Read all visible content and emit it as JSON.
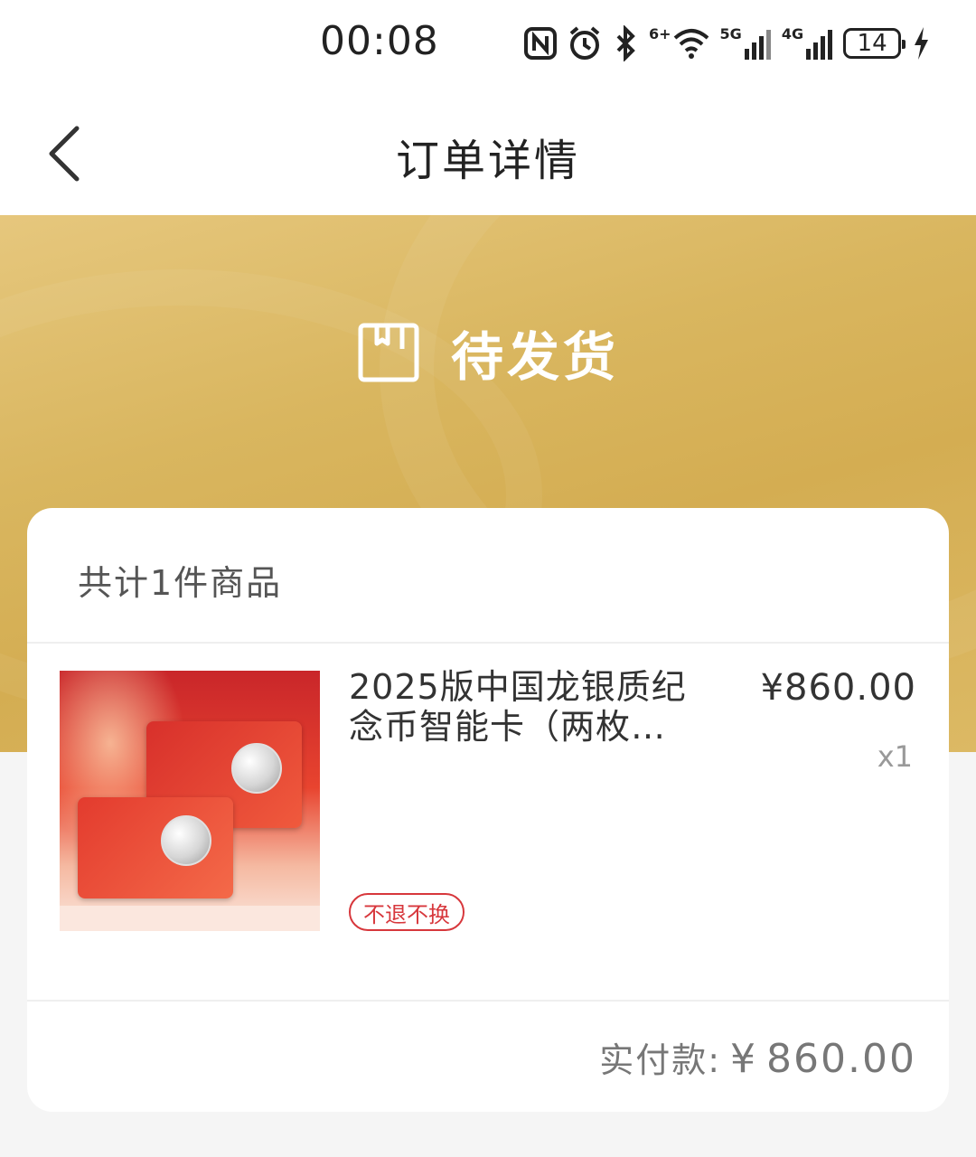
{
  "status_bar": {
    "time": "00:08",
    "network_1": "5G",
    "network_2": "4G",
    "wifi_tag": "6+",
    "battery": "14"
  },
  "nav": {
    "title": "订单详情"
  },
  "order_status": {
    "label": "待发货"
  },
  "summary": {
    "item_count_text": "共计1件商品"
  },
  "product": {
    "title": "2025版中国龙银质纪念币智能卡（两枚…",
    "price": "¥860.00",
    "quantity": "x1",
    "tag": "不退不换"
  },
  "payment": {
    "label": "实付款:",
    "currency": "¥",
    "amount": "860.00"
  },
  "colors": {
    "gold_header": "#d9b65f",
    "tag_red": "#d7373c",
    "background": "#f5f5f5"
  },
  "icons": [
    "back-chevron-icon",
    "package-box-icon",
    "nfc-icon",
    "alarm-icon",
    "bluetooth-icon",
    "wifi-icon",
    "signal-icon",
    "charging-icon"
  ]
}
